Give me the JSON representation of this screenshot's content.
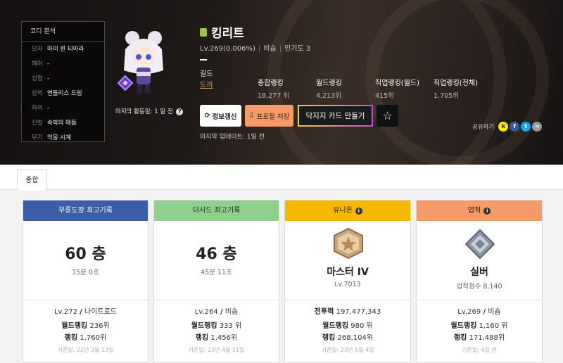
{
  "coordi": {
    "title": "코디 분석",
    "rows": [
      {
        "k": "모자",
        "v": "마이 퀸 티아라"
      },
      {
        "k": "헤어",
        "v": "-"
      },
      {
        "k": "성형",
        "v": "-"
      },
      {
        "k": "상의",
        "v": "엔들리스 드림"
      },
      {
        "k": "하의",
        "v": "-"
      },
      {
        "k": "신발",
        "v": "속박의 매듭"
      },
      {
        "k": "무기",
        "v": "악몽 시계"
      }
    ]
  },
  "character": {
    "name": "킹리트",
    "level": "Lv.269(0.006%)",
    "job": "비숍",
    "popularity": "인기도 3",
    "last_active": "마지막 활동일: 1 일 전",
    "guild_label": "길드",
    "guild_value": "도끼"
  },
  "ranks": [
    {
      "label": "종합랭킹",
      "value": "18,277 위"
    },
    {
      "label": "월드랭킹",
      "value": "4,213위"
    },
    {
      "label": "직업랭킹(월드)",
      "value": "415위"
    },
    {
      "label": "직업랭킹(전체)",
      "value": "1,705위"
    }
  ],
  "actions": {
    "refresh": "정보갱신",
    "save": "프로필 저장",
    "card": "닥지지 카드 만들기",
    "updated": "마지막 업데이트: 1일 전",
    "share": "공유하기"
  },
  "tabs": [
    "종합"
  ],
  "colors": {
    "dojo": "#3b5ea8",
    "seed": "#8fd18a",
    "union": "#f5b700",
    "achieve": "#f59b6a"
  },
  "cards": [
    {
      "title": "무릉도장 최고기록",
      "big": "60 층",
      "small": "15분 0초",
      "l1": "Lv.272",
      "l1b": "나이트로드",
      "l2a": "월드랭킹",
      "l2b": "236위",
      "l3a": "랭킹",
      "l3b": "1,760위",
      "date": "기준일: 22년 3월 13일"
    },
    {
      "title": "더시드 최고기록",
      "big": "46 층",
      "small": "45분 11초",
      "l1": "Lv.264",
      "l1b": "비숍",
      "l2a": "월드랭킹",
      "l2b": "333 위",
      "l3a": "랭킹",
      "l3b": "1,456위",
      "date": "기준일: 23년 4월 11일"
    },
    {
      "title": "유니온",
      "big": "마스터 IV",
      "small": "Lv.7013",
      "l1": "전투력",
      "l1b": "197,477,343",
      "l2a": "월드랭킹",
      "l2b": "980 위",
      "l3a": "랭킹",
      "l3b": "268,104위",
      "date": "기준일: 23년 5월 4일"
    },
    {
      "title": "업적",
      "big": "실버",
      "small": "업적점수 8,140",
      "l1": "Lv.269",
      "l1b": "비숍",
      "l2a": "월드랭킹",
      "l2b": "1,160 위",
      "l3a": "랭킹",
      "l3b": "171,488위",
      "date": "기준일: 4일 전"
    }
  ]
}
